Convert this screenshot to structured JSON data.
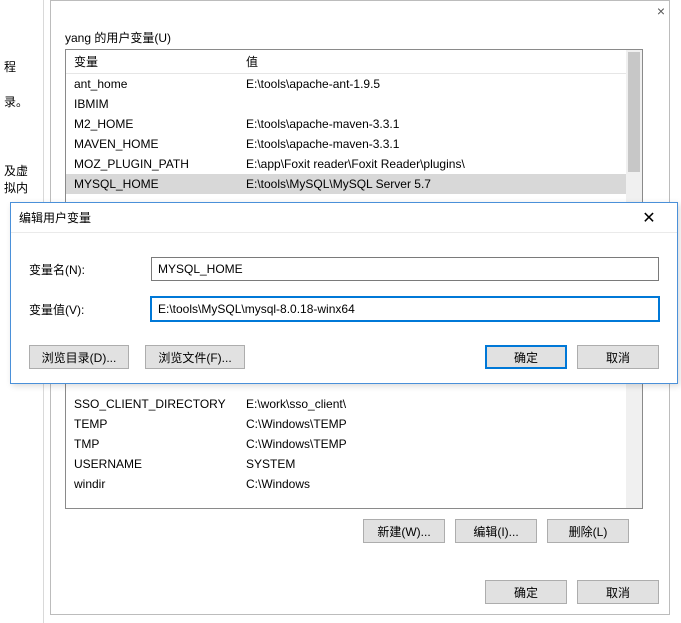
{
  "left": {
    "t1": "程",
    "t2": "录。",
    "t3": "及虚拟内"
  },
  "bg": {
    "section_label": "yang 的用户变量(U)",
    "header": {
      "var": "变量",
      "val": "值"
    },
    "rows_top": [
      {
        "var": "ant_home",
        "val": "E:\\tools\\apache-ant-1.9.5"
      },
      {
        "var": "IBMIM",
        "val": ""
      },
      {
        "var": "M2_HOME",
        "val": "E:\\tools\\apache-maven-3.3.1"
      },
      {
        "var": "MAVEN_HOME",
        "val": "E:\\tools\\apache-maven-3.3.1"
      },
      {
        "var": "MOZ_PLUGIN_PATH",
        "val": "E:\\app\\Foxit reader\\Foxit Reader\\plugins\\"
      },
      {
        "var": "MYSQL_HOME",
        "val": "E:\\tools\\MySQL\\MySQL Server 5.7",
        "selected": true
      }
    ],
    "rows_bottom_start": 344,
    "rows_bottom": [
      {
        "var": "SSO_CLIENT_DIRECTORY",
        "val": "E:\\work\\sso_client\\"
      },
      {
        "var": "TEMP",
        "val": "C:\\Windows\\TEMP"
      },
      {
        "var": "TMP",
        "val": "C:\\Windows\\TEMP"
      },
      {
        "var": "USERNAME",
        "val": "SYSTEM"
      },
      {
        "var": "windir",
        "val": "C:\\Windows"
      }
    ],
    "buttons": {
      "new": "新建(W)...",
      "edit": "编辑(I)...",
      "delete": "删除(L)"
    },
    "outer_buttons": {
      "ok": "确定",
      "cancel": "取消"
    }
  },
  "modal": {
    "title": "编辑用户变量",
    "name_label": "变量名(N):",
    "value_label": "变量值(V):",
    "name_value": "MYSQL_HOME",
    "value_value": "E:\\tools\\MySQL\\mysql-8.0.18-winx64",
    "browse_dir": "浏览目录(D)...",
    "browse_file": "浏览文件(F)...",
    "ok": "确定",
    "cancel": "取消"
  }
}
